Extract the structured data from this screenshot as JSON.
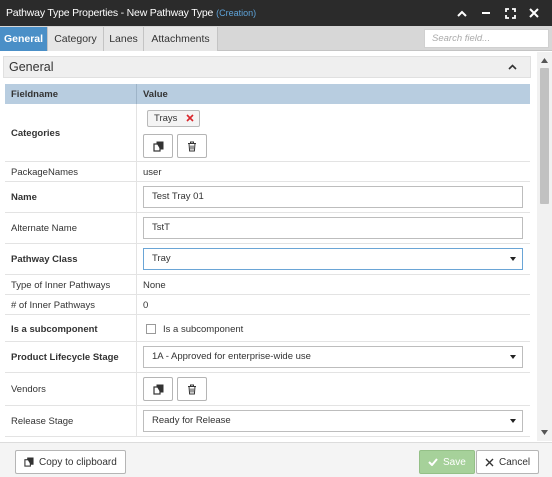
{
  "window": {
    "title": "Pathway Type Properties - New Pathway Type",
    "subtitle": "(Creation)"
  },
  "tabs": [
    "General",
    "Category",
    "Lanes",
    "Attachments"
  ],
  "active_tab": "General",
  "search": {
    "placeholder": "Search field..."
  },
  "section": {
    "title": "General"
  },
  "table": {
    "col_fieldname": "Fieldname",
    "col_value": "Value"
  },
  "fields": {
    "categories": {
      "label": "Categories",
      "chip": "Trays"
    },
    "package_names": {
      "label": "PackageNames",
      "value": "user"
    },
    "name": {
      "label": "Name",
      "value": "Test Tray 01"
    },
    "alternate_name": {
      "label": "Alternate Name",
      "value": "TstT"
    },
    "pathway_class": {
      "label": "Pathway Class",
      "value": "Tray"
    },
    "type_inner": {
      "label": "Type of Inner Pathways",
      "value": "None"
    },
    "num_inner": {
      "label": "# of Inner Pathways",
      "value": "0"
    },
    "subcomponent": {
      "label": "Is a subcomponent",
      "checkbox_label": "Is a subcomponent",
      "checked": false
    },
    "lifecycle": {
      "label": "Product Lifecycle Stage",
      "value": "1A - Approved for enterprise-wide use"
    },
    "vendors": {
      "label": "Vendors"
    },
    "release": {
      "label": "Release Stage",
      "value": "Ready for Release"
    }
  },
  "footer": {
    "copy": "Copy to clipboard",
    "save": "Save",
    "cancel": "Cancel"
  },
  "colors": {
    "titlebar": "#2b2b2b",
    "subtitle": "#5ea3d9",
    "active_tab": "#4a8fc7",
    "column_header": "#b8cde0",
    "save_button": "#a6d19a",
    "remove_x": "#d9262c"
  }
}
